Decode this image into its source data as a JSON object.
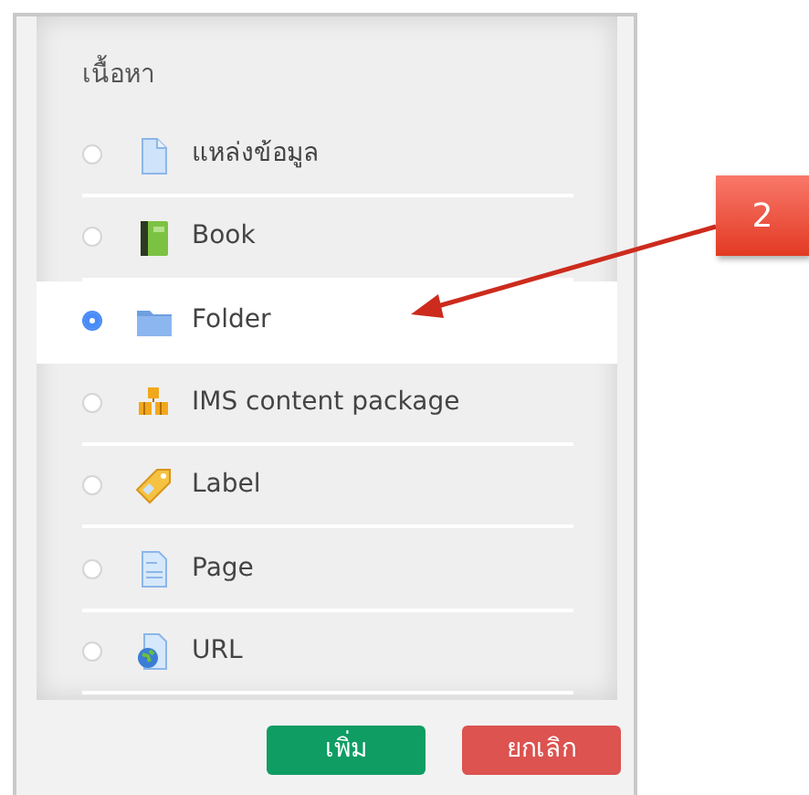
{
  "section_title": "เนื้อหา",
  "items": [
    {
      "label": "แหล่งข้อมูล",
      "kind": "file",
      "selected": false
    },
    {
      "label": "Book",
      "kind": "book",
      "selected": false
    },
    {
      "label": "Folder",
      "kind": "folder",
      "selected": true
    },
    {
      "label": "IMS content package",
      "kind": "package",
      "selected": false
    },
    {
      "label": "Label",
      "kind": "tag",
      "selected": false
    },
    {
      "label": "Page",
      "kind": "page",
      "selected": false
    },
    {
      "label": "URL",
      "kind": "url",
      "selected": false
    }
  ],
  "buttons": [
    {
      "label": "เพิ่ม",
      "kind": "primary"
    },
    {
      "label": "ยกเลิก",
      "kind": "cancel"
    }
  ],
  "callout": {
    "label": "2"
  }
}
